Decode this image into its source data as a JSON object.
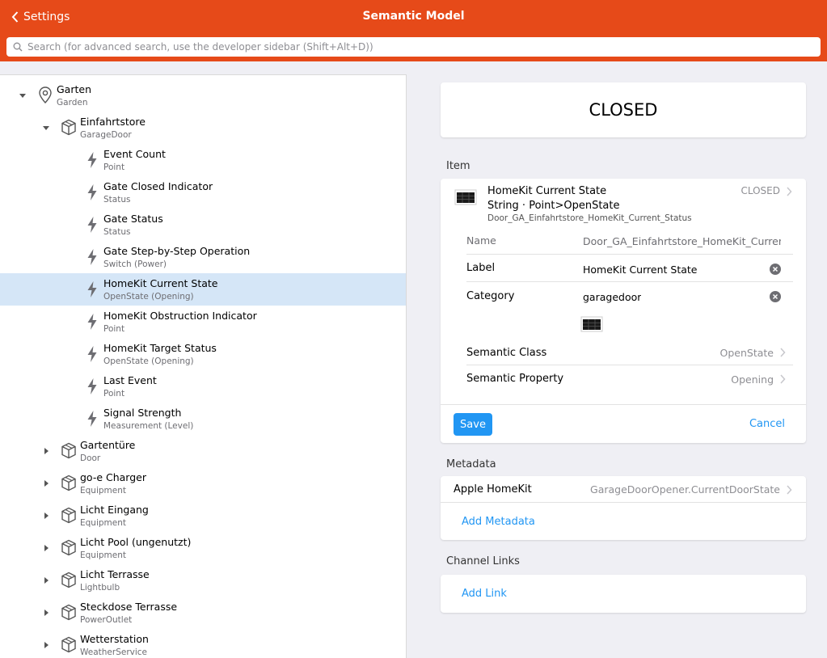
{
  "header": {
    "back_label": "Settings",
    "title": "Semantic Model",
    "search_placeholder": "Search (for advanced search, use the developer sidebar (Shift+Alt+D))",
    "background_color": "#e64a19"
  },
  "tree": {
    "items": [
      {
        "label": "Garten",
        "sub": "Garden",
        "icon": "location-pin-icon"
      },
      {
        "label": "Einfahrtstore",
        "sub": "GarageDoor",
        "icon": "cube-icon"
      },
      {
        "label": "Event Count",
        "sub": "Point",
        "icon": "bolt-icon"
      },
      {
        "label": "Gate Closed Indicator",
        "sub": "Status",
        "icon": "bolt-icon"
      },
      {
        "label": "Gate Status",
        "sub": "Status",
        "icon": "bolt-icon"
      },
      {
        "label": "Gate Step-by-Step Operation",
        "sub": "Switch (Power)",
        "icon": "bolt-icon"
      },
      {
        "label": "HomeKit Current State",
        "sub": "OpenState (Opening)",
        "icon": "bolt-icon",
        "selected": true
      },
      {
        "label": "HomeKit Obstruction Indicator",
        "sub": "Point",
        "icon": "bolt-icon"
      },
      {
        "label": "HomeKit Target Status",
        "sub": "OpenState (Opening)",
        "icon": "bolt-icon"
      },
      {
        "label": "Last Event",
        "sub": "Point",
        "icon": "bolt-icon"
      },
      {
        "label": "Signal Strength",
        "sub": "Measurement (Level)",
        "icon": "bolt-icon"
      },
      {
        "label": "Gartentüre",
        "sub": "Door",
        "icon": "cube-icon"
      },
      {
        "label": "go-e Charger",
        "sub": "Equipment",
        "icon": "cube-icon"
      },
      {
        "label": "Licht Eingang",
        "sub": "Equipment",
        "icon": "cube-icon"
      },
      {
        "label": "Licht Pool (ungenutzt)",
        "sub": "Equipment",
        "icon": "cube-icon"
      },
      {
        "label": "Licht Terrasse",
        "sub": "Lightbulb",
        "icon": "cube-icon"
      },
      {
        "label": "Steckdose Terrasse",
        "sub": "PowerOutlet",
        "icon": "cube-icon"
      },
      {
        "label": "Wetterstation",
        "sub": "WeatherService",
        "icon": "cube-icon"
      }
    ],
    "selected_color": "#d5e6f7"
  },
  "state": {
    "value": "CLOSED"
  },
  "item": {
    "section_title": "Item",
    "title": "HomeKit Current State",
    "type": "String · Point>OpenState",
    "name": "Door_GA_Einfahrtstore_HomeKit_Current_Status",
    "state": "CLOSED",
    "fields": {
      "name_label": "Name",
      "name_value": "Door_GA_Einfahrtstore_HomeKit_Current_Status",
      "label_label": "Label",
      "label_value": "HomeKit Current State",
      "category_label": "Category",
      "category_value": "garagedoor",
      "semantic_class_label": "Semantic Class",
      "semantic_class_value": "OpenState",
      "semantic_property_label": "Semantic Property",
      "semantic_property_value": "Opening"
    },
    "save_label": "Save",
    "cancel_label": "Cancel",
    "accent_color": "#2196f3"
  },
  "metadata": {
    "section_title": "Metadata",
    "entries": [
      {
        "label": "Apple HomeKit",
        "value": "GarageDoorOpener.CurrentDoorState"
      }
    ],
    "add_label": "Add Metadata"
  },
  "channel_links": {
    "section_title": "Channel Links",
    "add_label": "Add Link"
  }
}
